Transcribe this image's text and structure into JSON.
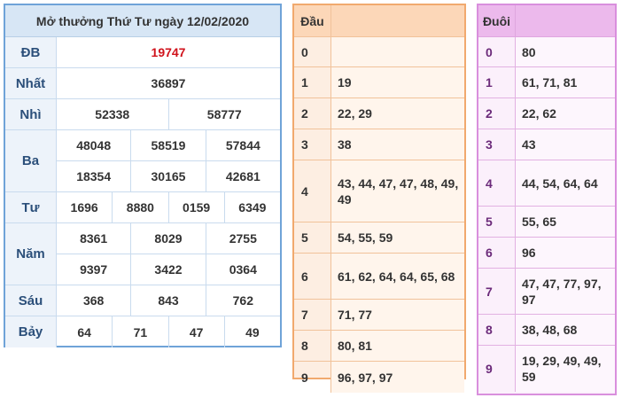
{
  "result": {
    "title": "Mở thưởng Thứ Tư ngày 12/02/2020",
    "prizes": [
      {
        "label": "ĐB",
        "lines": [
          [
            "19747"
          ]
        ]
      },
      {
        "label": "Nhất",
        "lines": [
          [
            "36897"
          ]
        ]
      },
      {
        "label": "Nhì",
        "lines": [
          [
            "52338",
            "58777"
          ]
        ]
      },
      {
        "label": "Ba",
        "lines": [
          [
            "48048",
            "58519",
            "57844"
          ],
          [
            "18354",
            "30165",
            "42681"
          ]
        ]
      },
      {
        "label": "Tư",
        "lines": [
          [
            "1696",
            "8880",
            "0159",
            "6349"
          ]
        ]
      },
      {
        "label": "Năm",
        "lines": [
          [
            "8361",
            "8029",
            "2755"
          ],
          [
            "9397",
            "3422",
            "0364"
          ]
        ]
      },
      {
        "label": "Sáu",
        "lines": [
          [
            "368",
            "843",
            "762"
          ]
        ]
      },
      {
        "label": "Bảy",
        "lines": [
          [
            "64",
            "71",
            "47",
            "49"
          ]
        ]
      }
    ],
    "special_color": "#d0121b"
  },
  "dau": {
    "header": "Đầu",
    "rows": [
      {
        "key": "0",
        "value": ""
      },
      {
        "key": "1",
        "value": "19"
      },
      {
        "key": "2",
        "value": "22, 29"
      },
      {
        "key": "3",
        "value": "38"
      },
      {
        "key": "4",
        "value": "43, 44, 47, 47, 48, 49, 49"
      },
      {
        "key": "5",
        "value": "54, 55, 59"
      },
      {
        "key": "6",
        "value": "61, 62, 64, 64, 65, 68"
      },
      {
        "key": "7",
        "value": "71, 77"
      },
      {
        "key": "8",
        "value": "80, 81"
      },
      {
        "key": "9",
        "value": "96, 97, 97"
      }
    ]
  },
  "duoi": {
    "header": "Đuôi",
    "rows": [
      {
        "key": "0",
        "value": "80"
      },
      {
        "key": "1",
        "value": "61, 71, 81"
      },
      {
        "key": "2",
        "value": "22, 62"
      },
      {
        "key": "3",
        "value": "43"
      },
      {
        "key": "4",
        "value": "44, 54, 64, 64"
      },
      {
        "key": "5",
        "value": "55, 65"
      },
      {
        "key": "6",
        "value": "96"
      },
      {
        "key": "7",
        "value": "47, 47, 77, 97, 97"
      },
      {
        "key": "8",
        "value": "38, 48, 68"
      },
      {
        "key": "9",
        "value": "19, 29, 49, 49, 59"
      }
    ]
  }
}
